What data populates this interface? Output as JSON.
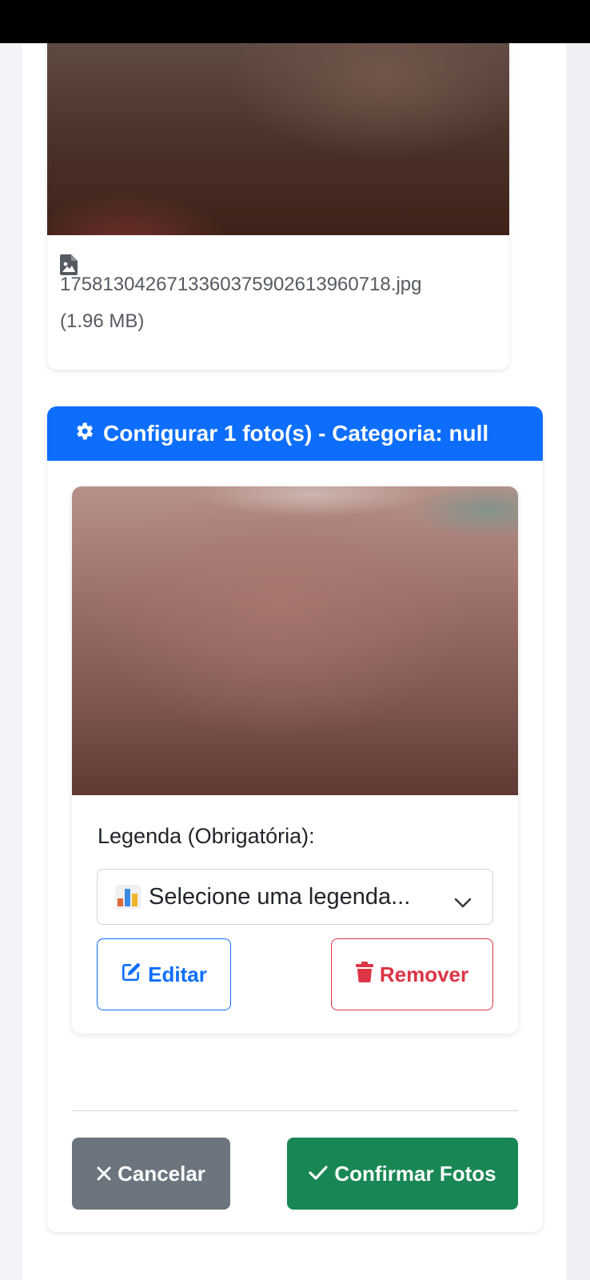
{
  "file": {
    "name": "1758130426713360375902613960718.jpg",
    "size": "(1.96 MB)",
    "icon": "file-image-icon"
  },
  "config": {
    "header_title": "Configurar 1 foto(s) - Categoria: null",
    "header_icon": "gear-icon",
    "header_color": "#0d6efd",
    "legend_label": "Legenda (Obrigatória):",
    "legend_select_value": "Selecione uma legenda...",
    "legend_select_icon": "bar-chart-emoji-icon",
    "edit_label": "Editar",
    "remove_label": "Remover",
    "cancel_label": "Cancelar",
    "confirm_label": "Confirmar Fotos"
  },
  "colors": {
    "primary": "#0d6efd",
    "danger": "#dc3545",
    "secondary": "#6c757d",
    "success": "#198754"
  }
}
